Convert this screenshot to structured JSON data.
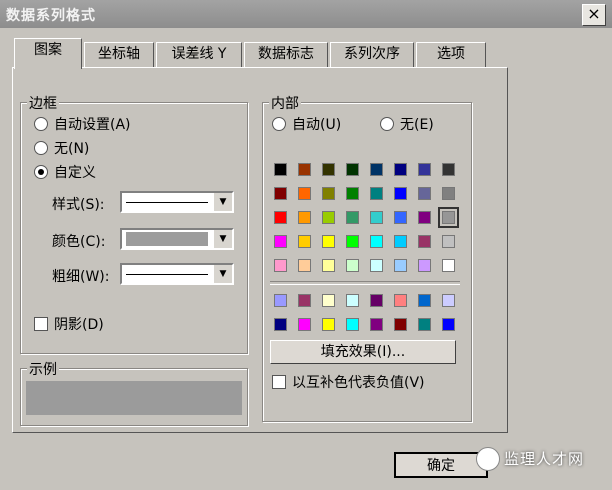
{
  "title": "数据系列格式",
  "close_glyph": "×",
  "tabs": [
    {
      "label": "图案",
      "active": true
    },
    {
      "label": "坐标轴"
    },
    {
      "label": "误差线 Y"
    },
    {
      "label": "数据标志"
    },
    {
      "label": "系列次序"
    },
    {
      "label": "选项"
    }
  ],
  "border": {
    "label": "边框",
    "auto": "自动设置(A)",
    "none": "无(N)",
    "custom": "自定义",
    "style_label": "样式(S):",
    "color_label": "颜色(C):",
    "weight_label": "粗细(W):",
    "shadow_label": "阴影(D)",
    "selected": "custom"
  },
  "sample_label": "示例",
  "area": {
    "label": "内部",
    "auto": "自动(U)",
    "none": "无(E)",
    "palette_top": [
      [
        "#000000",
        "#993300",
        "#333300",
        "#003300",
        "#003366",
        "#000080",
        "#333399",
        "#333333"
      ],
      [
        "#800000",
        "#ff6600",
        "#808000",
        "#008000",
        "#008080",
        "#0000ff",
        "#666699",
        "#808080"
      ],
      [
        "#ff0000",
        "#ff9900",
        "#99cc00",
        "#339966",
        "#33cccc",
        "#3366ff",
        "#800080",
        "#969696"
      ],
      [
        "#ff00ff",
        "#ffcc00",
        "#ffff00",
        "#00ff00",
        "#00ffff",
        "#00ccff",
        "#993366",
        "#c0c0c0"
      ],
      [
        "#ff99cc",
        "#ffcc99",
        "#ffff99",
        "#ccffcc",
        "#ccffff",
        "#99ccff",
        "#cc99ff",
        "#ffffff"
      ]
    ],
    "palette_bottom": [
      [
        "#9999ff",
        "#993366",
        "#ffffcc",
        "#ccffff",
        "#660066",
        "#ff8080",
        "#0066cc",
        "#ccccff"
      ],
      [
        "#000080",
        "#ff00ff",
        "#ffff00",
        "#00ffff",
        "#800080",
        "#800000",
        "#008080",
        "#0000ff"
      ]
    ],
    "fill_effects": "填充效果(I)...",
    "invert_label": "以互补色代表负值(V)"
  },
  "ok_label": "确定",
  "watermark": "监理人才网"
}
